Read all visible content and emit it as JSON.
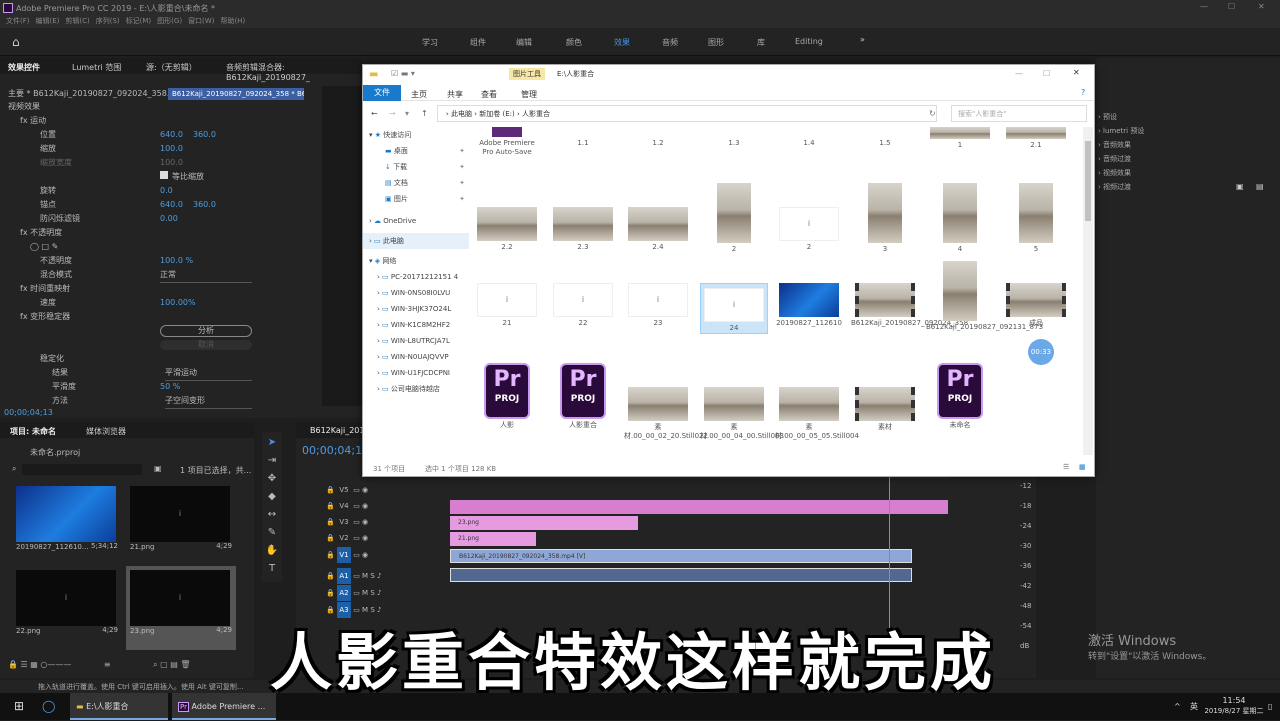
{
  "titlebar": {
    "title": "Adobe Premiere Pro CC 2019 - E:\\人影重合\\未命名 *"
  },
  "menubar": [
    "文件(F)",
    "编辑(E)",
    "剪辑(C)",
    "序列(S)",
    "标记(M)",
    "图形(G)",
    "窗口(W)",
    "帮助(H)"
  ],
  "workspace_tabs": [
    "学习",
    "组件",
    "编辑",
    "颜色",
    "效果",
    "音频",
    "图形",
    "库",
    "Editing"
  ],
  "effect_controls": {
    "tabs": [
      "效果控件",
      "Lumetri 范围",
      "源:（无剪辑）",
      "音频剪辑混合器: B612Kaji_20190827_"
    ],
    "source": "主要 * B612Kaji_20190827_092024_358...",
    "sequence": "B612Kaji_20190827_092024_358 * B6...",
    "video_effects": "视频效果",
    "motion": "运动",
    "position": "位置",
    "position_x": "640.0",
    "position_y": "360.0",
    "scale": "缩放",
    "scale_v": "100.0",
    "scale_width": "缩放宽度",
    "scale_width_v": "100.0",
    "uniform_scale": "等比缩放",
    "rotation": "旋转",
    "rotation_v": "0.0",
    "anchor": "锚点",
    "anchor_x": "640.0",
    "anchor_y": "360.0",
    "antiflicker": "防闪烁滤镜",
    "antiflicker_v": "0.00",
    "opacity_group": "不透明度",
    "opacity": "不透明度",
    "opacity_v": "100.0 %",
    "blend": "混合模式",
    "blend_v": "正常",
    "time_remap": "时间重映射",
    "speed": "速度",
    "speed_v": "100.00%",
    "stabilizer": "变形稳定器",
    "analyze": "分析",
    "cancel": "取消",
    "stabilize": "稳定化",
    "result": "结果",
    "result_v": "平滑运动",
    "smoothness": "平滑度",
    "smoothness_v": "50 %",
    "method": "方法",
    "method_v": "子空间变形",
    "timecode": "00;00;04;13"
  },
  "project": {
    "tabs": [
      "项目: 未命名",
      "媒体浏览器"
    ],
    "file": "未命名.prproj",
    "selection": "1 项目已选择，共...",
    "items": [
      {
        "name": "20190827_112610...",
        "dur": "5;34;12"
      },
      {
        "name": "21.png",
        "dur": "4;29"
      },
      {
        "name": "22.png",
        "dur": "4;29"
      },
      {
        "name": "23.png",
        "dur": "4;29"
      }
    ]
  },
  "timeline": {
    "seq_tab": "B612Kaji_20190",
    "timecode": "00;00;04;13",
    "tracks_v": [
      "V5",
      "V4",
      "V3",
      "V2",
      "V1"
    ],
    "tracks_a": [
      "A1",
      "A2",
      "A3"
    ],
    "clips": {
      "v3": "23.png",
      "v2": "21.png",
      "v1": "B612Kaji_20190827_092024_358.mp4 [V]"
    },
    "meter_labels": [
      "-12",
      "-18",
      "-24",
      "-30",
      "-36",
      "-42",
      "-48",
      "-54",
      "dB"
    ]
  },
  "explorer": {
    "ribbon_tool": "图片工具",
    "path_title": "E:\\人影重合",
    "ribbon_tabs": [
      "文件",
      "主页",
      "共享",
      "查看",
      "管理"
    ],
    "breadcrumb": [
      "此电脑",
      "新加卷 (E:)",
      "人影重合"
    ],
    "search_placeholder": "搜索\"人影重合\"",
    "nav": {
      "quick_access": "快速访问",
      "quick_items": [
        "桌面",
        "下载",
        "文档",
        "图片"
      ],
      "onedrive": "OneDrive",
      "this_pc": "此电脑",
      "network": "网络",
      "network_items": [
        "PC-20171212151 4",
        "WIN-0NS08I0LVU",
        "WIN-3HJK37O24L",
        "WIN-K1C8M2HF2",
        "WIN-L8UTRCJA7L",
        "WIN-N0UAJQVVP",
        "WIN-U1FJCDCPNI",
        "公司电脑待越店"
      ]
    },
    "row0": [
      "Adobe Premiere Pro Auto-Save",
      "1.1",
      "1.2",
      "1.3",
      "1.4",
      "1.5",
      "1",
      "2.1"
    ],
    "row1": [
      "2.2",
      "2.3",
      "2.4",
      "2",
      "2",
      "3",
      "4",
      "5"
    ],
    "row2": [
      "21",
      "22",
      "23",
      "24",
      "20190827_112610",
      "B612Kaji_20190827_092024_358",
      "B612Kaji_20190827_092131_873",
      "成品"
    ],
    "row3": [
      "人影",
      "人影重合",
      "素材.00_00_02_20.Still022",
      "素材.00_00_04_00.Still003",
      "素材.00_00_05_05.Still004",
      "素材",
      "未命名"
    ],
    "blank_glyph": "ⅰ",
    "proj_pr": "Pr",
    "proj_label": "PROJ",
    "badge": "00:33",
    "status_count": "31 个项目",
    "status_sel": "选中 1 个项目  128 KB"
  },
  "right_panel": {
    "items": [
      "预设",
      "lumetri 预设",
      "音频效果",
      "音频过渡",
      "视频效果",
      "视频过渡"
    ]
  },
  "subtitle": "人影重合特效这样就完成",
  "watermark": {
    "line1": "激活 Windows",
    "line2": "转到\"设置\"以激活 Windows。"
  },
  "status_bar": "拖入轨道进行覆盖。使用 Ctrl 键可启用插入。使用 Alt 键可复制...",
  "taskbar": {
    "app1": "E:\\人影重合",
    "app2": "Adobe Premiere ...",
    "ime": "英",
    "time": "11:54",
    "date": "2019/8/27 星期二"
  }
}
